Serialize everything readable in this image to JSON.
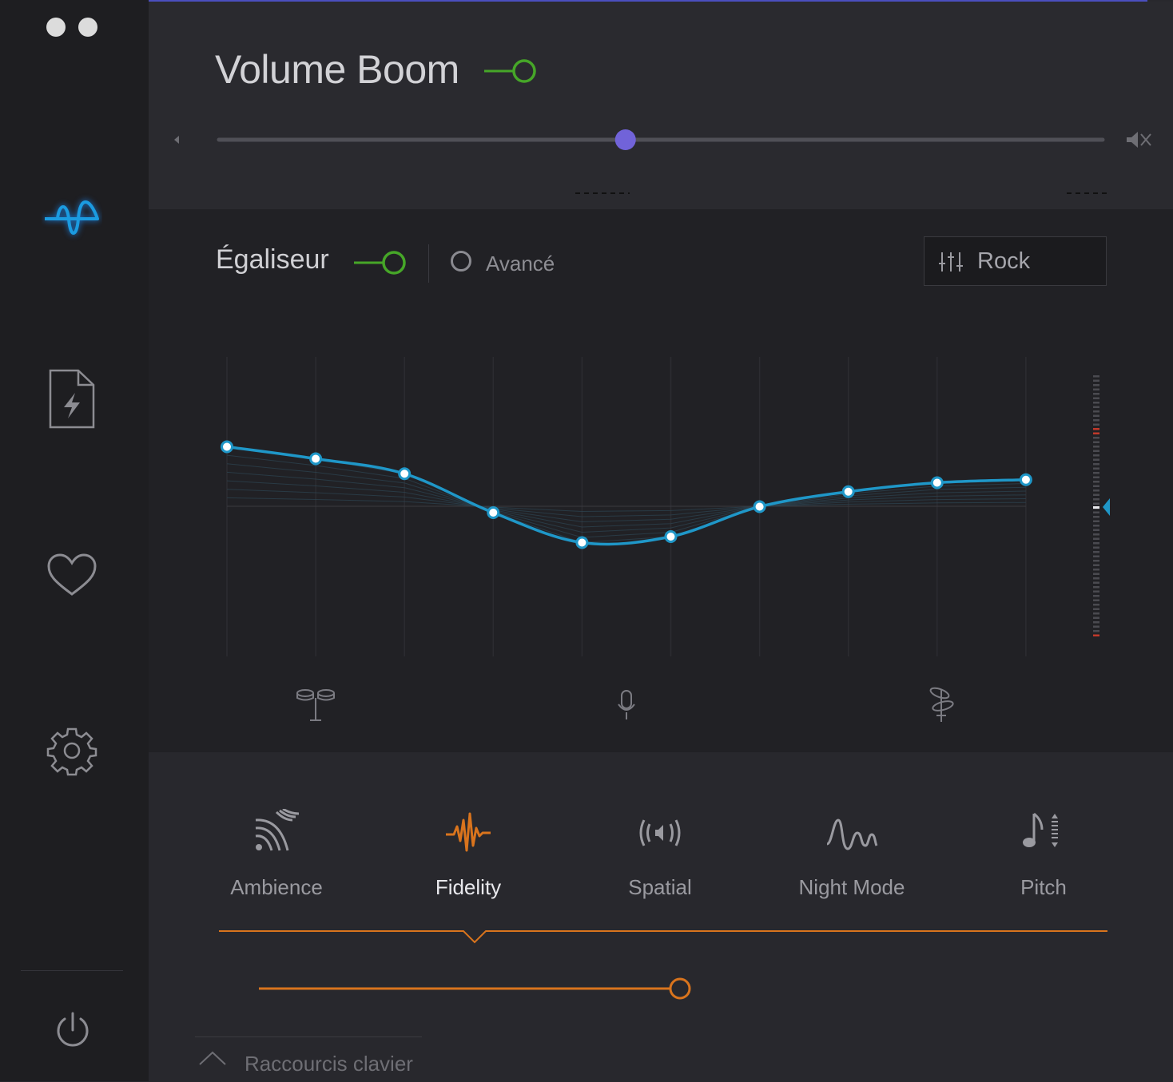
{
  "window": {
    "controls": [
      "close",
      "minimize"
    ]
  },
  "sidebar": {
    "items": [
      {
        "name": "equalizer",
        "icon": "sine-wave-icon",
        "active": true
      },
      {
        "name": "files",
        "icon": "bolt-file-icon"
      },
      {
        "name": "favorites",
        "icon": "heart-icon"
      },
      {
        "name": "settings",
        "icon": "gear-icon"
      }
    ],
    "power_icon": "power-icon"
  },
  "volume_boom": {
    "title": "Volume Boom",
    "enabled": true,
    "level": 0.46,
    "accent_start": "#1aa0d0",
    "accent_end": "#7560d8"
  },
  "equalizer": {
    "title": "Égaliseur",
    "enabled": true,
    "advanced_label": "Avancé",
    "advanced_enabled": false,
    "preset": "Rock",
    "curve_color": "#1f97c8",
    "band_levels": [
      0.7,
      0.66,
      0.61,
      0.48,
      0.38,
      0.4,
      0.5,
      0.55,
      0.58,
      0.59
    ],
    "level_indicator": 0.5,
    "band_group_icons": [
      "drums-icon",
      "microphone-icon",
      "cymbal-icon"
    ]
  },
  "effects": {
    "items": [
      {
        "label": "Ambience",
        "icon": "ambience-icon",
        "active": false
      },
      {
        "label": "Fidelity",
        "icon": "fidelity-icon",
        "active": true
      },
      {
        "label": "Spatial",
        "icon": "spatial-icon",
        "active": false
      },
      {
        "label": "Night Mode",
        "icon": "night-mode-icon",
        "active": false
      },
      {
        "label": "Pitch",
        "icon": "pitch-icon",
        "active": false
      }
    ],
    "active_color": "#d9741d",
    "fidelity_level": 1.0
  },
  "footer": {
    "shortcuts_label": "Raccourcis clavier"
  }
}
